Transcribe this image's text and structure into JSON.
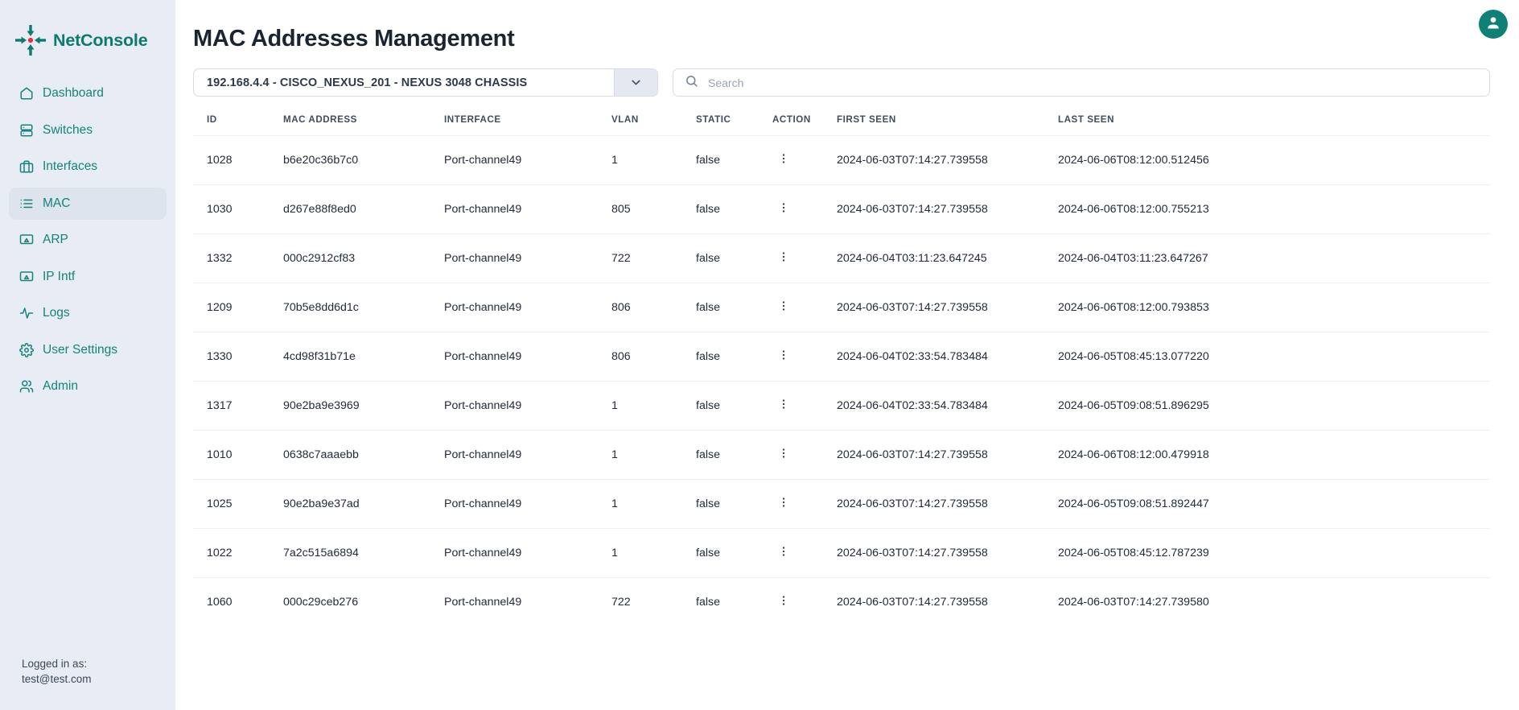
{
  "brand": {
    "name": "NetConsole",
    "logo_icon": "converging-arrows-logo"
  },
  "sidebar": {
    "items": [
      {
        "label": "Dashboard",
        "icon": "home-icon",
        "active": false
      },
      {
        "label": "Switches",
        "icon": "server-icon",
        "active": false
      },
      {
        "label": "Interfaces",
        "icon": "briefcase-icon",
        "active": false
      },
      {
        "label": "MAC",
        "icon": "list-icon",
        "active": true
      },
      {
        "label": "ARP",
        "icon": "monitor-icon",
        "active": false
      },
      {
        "label": "IP Intf",
        "icon": "monitor-icon",
        "active": false
      },
      {
        "label": "Logs",
        "icon": "activity-icon",
        "active": false
      },
      {
        "label": "User Settings",
        "icon": "gear-icon",
        "active": false
      },
      {
        "label": "Admin",
        "icon": "users-icon",
        "active": false
      }
    ],
    "logged_in_label": "Logged in as:",
    "logged_in_user": "test@test.com"
  },
  "header": {
    "title": "MAC Addresses Management",
    "avatar_icon": "user-avatar-icon"
  },
  "device_select": {
    "value": "192.168.4.4 - CISCO_NEXUS_201 - NEXUS 3048 CHASSIS",
    "chevron_icon": "chevron-down-icon"
  },
  "search": {
    "placeholder": "Search",
    "value": "",
    "icon": "search-icon"
  },
  "table": {
    "columns": [
      "ID",
      "MAC ADDRESS",
      "INTERFACE",
      "VLAN",
      "STATIC",
      "ACTION",
      "FIRST SEEN",
      "LAST SEEN"
    ],
    "action_icon": "more-vertical-icon",
    "rows": [
      {
        "id": "1028",
        "mac": "b6e20c36b7c0",
        "interface": "Port-channel49",
        "vlan": "1",
        "static": "false",
        "first_seen": "2024-06-03T07:14:27.739558",
        "last_seen": "2024-06-06T08:12:00.512456"
      },
      {
        "id": "1030",
        "mac": "d267e88f8ed0",
        "interface": "Port-channel49",
        "vlan": "805",
        "static": "false",
        "first_seen": "2024-06-03T07:14:27.739558",
        "last_seen": "2024-06-06T08:12:00.755213"
      },
      {
        "id": "1332",
        "mac": "000c2912cf83",
        "interface": "Port-channel49",
        "vlan": "722",
        "static": "false",
        "first_seen": "2024-06-04T03:11:23.647245",
        "last_seen": "2024-06-04T03:11:23.647267"
      },
      {
        "id": "1209",
        "mac": "70b5e8dd6d1c",
        "interface": "Port-channel49",
        "vlan": "806",
        "static": "false",
        "first_seen": "2024-06-03T07:14:27.739558",
        "last_seen": "2024-06-06T08:12:00.793853"
      },
      {
        "id": "1330",
        "mac": "4cd98f31b71e",
        "interface": "Port-channel49",
        "vlan": "806",
        "static": "false",
        "first_seen": "2024-06-04T02:33:54.783484",
        "last_seen": "2024-06-05T08:45:13.077220"
      },
      {
        "id": "1317",
        "mac": "90e2ba9e3969",
        "interface": "Port-channel49",
        "vlan": "1",
        "static": "false",
        "first_seen": "2024-06-04T02:33:54.783484",
        "last_seen": "2024-06-05T09:08:51.896295"
      },
      {
        "id": "1010",
        "mac": "0638c7aaaebb",
        "interface": "Port-channel49",
        "vlan": "1",
        "static": "false",
        "first_seen": "2024-06-03T07:14:27.739558",
        "last_seen": "2024-06-06T08:12:00.479918"
      },
      {
        "id": "1025",
        "mac": "90e2ba9e37ad",
        "interface": "Port-channel49",
        "vlan": "1",
        "static": "false",
        "first_seen": "2024-06-03T07:14:27.739558",
        "last_seen": "2024-06-05T09:08:51.892447"
      },
      {
        "id": "1022",
        "mac": "7a2c515a6894",
        "interface": "Port-channel49",
        "vlan": "1",
        "static": "false",
        "first_seen": "2024-06-03T07:14:27.739558",
        "last_seen": "2024-06-05T08:45:12.787239"
      },
      {
        "id": "1060",
        "mac": "000c29ceb276",
        "interface": "Port-channel49",
        "vlan": "722",
        "static": "false",
        "first_seen": "2024-06-03T07:14:27.739558",
        "last_seen": "2024-06-03T07:14:27.739580"
      }
    ]
  },
  "colors": {
    "brand_teal": "#0d7a70",
    "sidebar_bg": "#e8edf5",
    "sidebar_active": "#dde4ee",
    "accent_red": "#e8323c"
  }
}
